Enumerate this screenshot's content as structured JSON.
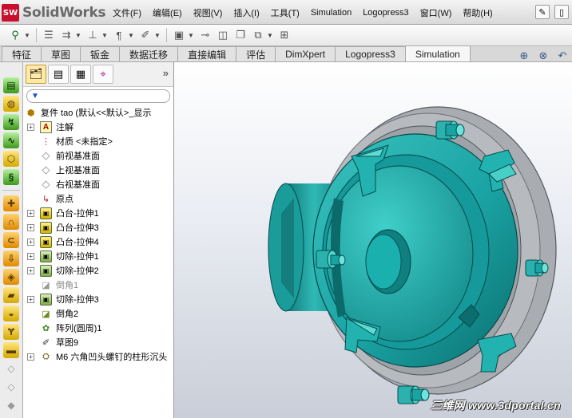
{
  "app": {
    "brand_badge": "SW",
    "brand_name": "SolidWorks"
  },
  "menu": [
    "文件(F)",
    "编辑(E)",
    "视图(V)",
    "插入(I)",
    "工具(T)",
    "Simulation",
    "Logopress3",
    "窗口(W)",
    "帮助(H)"
  ],
  "command_tabs": [
    {
      "label": "特征",
      "active": false
    },
    {
      "label": "草图",
      "active": false
    },
    {
      "label": "钣金",
      "active": false
    },
    {
      "label": "数据迁移",
      "active": false
    },
    {
      "label": "直接编辑",
      "active": false
    },
    {
      "label": "评估",
      "active": false
    },
    {
      "label": "DimXpert",
      "active": false
    },
    {
      "label": "Logopress3",
      "active": false
    },
    {
      "label": "Simulation",
      "active": true
    }
  ],
  "feature_tree": {
    "root": "复件 tao  (默认<<默认>_显示",
    "items": [
      {
        "label": "注解",
        "icon": "annotation-icon",
        "expand": true,
        "kind": "note"
      },
      {
        "label": "材质 <未指定>",
        "icon": "material-icon",
        "expand": false,
        "kind": "material"
      },
      {
        "label": "前视基准面",
        "icon": "plane-icon",
        "expand": false,
        "kind": "plane"
      },
      {
        "label": "上视基准面",
        "icon": "plane-icon",
        "expand": false,
        "kind": "plane"
      },
      {
        "label": "右视基准面",
        "icon": "plane-icon",
        "expand": false,
        "kind": "plane"
      },
      {
        "label": "原点",
        "icon": "origin-icon",
        "expand": false,
        "kind": "origin"
      },
      {
        "label": "凸台-拉伸1",
        "icon": "boss-extrude-icon",
        "expand": true,
        "kind": "feat"
      },
      {
        "label": "凸台-拉伸3",
        "icon": "boss-extrude-icon",
        "expand": true,
        "kind": "feat"
      },
      {
        "label": "凸台-拉伸4",
        "icon": "boss-extrude-icon",
        "expand": true,
        "kind": "feat"
      },
      {
        "label": "切除-拉伸1",
        "icon": "cut-extrude-icon",
        "expand": true,
        "kind": "cut"
      },
      {
        "label": "切除-拉伸2",
        "icon": "cut-extrude-icon",
        "expand": true,
        "kind": "cut"
      },
      {
        "label": "倒角1",
        "icon": "chamfer-icon",
        "expand": false,
        "kind": "chamfer-gray"
      },
      {
        "label": "切除-拉伸3",
        "icon": "cut-extrude-icon",
        "expand": true,
        "kind": "cut"
      },
      {
        "label": "倒角2",
        "icon": "chamfer-icon",
        "expand": false,
        "kind": "chamfer"
      },
      {
        "label": "阵列(圆周)1",
        "icon": "circular-pattern-icon",
        "expand": false,
        "kind": "pattern"
      },
      {
        "label": "草图9",
        "icon": "sketch-icon",
        "expand": false,
        "kind": "sketch"
      },
      {
        "label": "M6 六角凹头螺钉的柱形沉头",
        "icon": "hole-wizard-icon",
        "expand": true,
        "kind": "hole"
      }
    ]
  },
  "watermark": "三维网 www.3dportal.cn",
  "colors": {
    "part_teal": "#1aa3a3",
    "part_teal_dark": "#0d6d6d",
    "part_teal_light": "#3fc9c4",
    "ring_gray": "#a6a9ad"
  }
}
